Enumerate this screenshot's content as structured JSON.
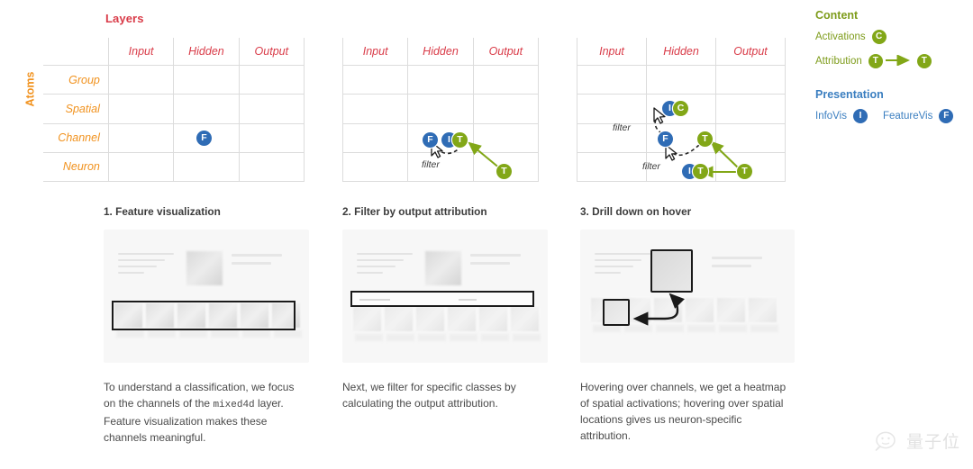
{
  "matrix": {
    "title": "Layers",
    "axis_label_y": "Atoms",
    "columns": [
      "Input",
      "Hidden",
      "Output"
    ],
    "rows": [
      "Group",
      "Spatial",
      "Channel",
      "Neuron"
    ],
    "filter_label": "filter",
    "colors": {
      "title": "#d93b48",
      "column_header": "#d93b48",
      "row_label": "#f1921e",
      "axis_label": "#f1921e",
      "grid": "#dcdcdc",
      "badge_blue": "#2f6cb5",
      "badge_green": "#82a717"
    },
    "instances": [
      {
        "id": "matrix-1",
        "badges": [
          {
            "letter": "F",
            "color": "blue",
            "row": "Channel",
            "column": "Hidden"
          }
        ],
        "filters": []
      },
      {
        "id": "matrix-2",
        "badges": [
          {
            "letter": "F",
            "color": "blue",
            "row": "Channel",
            "column": "Hidden"
          },
          {
            "letter": "I",
            "color": "blue",
            "row": "Channel",
            "column": "Hidden"
          },
          {
            "letter": "T",
            "color": "green",
            "row": "Channel",
            "column": "Hidden"
          },
          {
            "letter": "T",
            "color": "green",
            "row": "Neuron",
            "column": "Output"
          }
        ],
        "filters": [
          "filter"
        ]
      },
      {
        "id": "matrix-3",
        "badges": [
          {
            "letter": "I",
            "color": "blue",
            "row": "Spatial",
            "column": "Hidden"
          },
          {
            "letter": "C",
            "color": "green",
            "row": "Spatial",
            "column": "Hidden"
          },
          {
            "letter": "F",
            "color": "blue",
            "row": "Channel",
            "column": "Hidden"
          },
          {
            "letter": "T",
            "color": "green",
            "row": "Channel",
            "column": "Hidden"
          },
          {
            "letter": "I",
            "color": "blue",
            "row": "Neuron",
            "column": "Hidden"
          },
          {
            "letter": "T",
            "color": "green",
            "row": "Neuron",
            "column": "Hidden"
          },
          {
            "letter": "T",
            "color": "green",
            "row": "Neuron",
            "column": "Output"
          }
        ],
        "filters": [
          "filter",
          "filter"
        ]
      }
    ]
  },
  "legend": {
    "content": {
      "heading": "Content",
      "items": [
        {
          "label": "Activations",
          "badge": "C",
          "color": "green"
        },
        {
          "label": "Attribution",
          "badge_from": "T",
          "badge_to": "T",
          "color": "green",
          "arrow": true
        }
      ]
    },
    "presentation": {
      "heading": "Presentation",
      "items": [
        {
          "label": "InfoVis",
          "badge": "I",
          "color": "blue"
        },
        {
          "label": "FeatureVis",
          "badge": "F",
          "color": "blue"
        }
      ]
    },
    "colors": {
      "content_heading": "#7e9c1b",
      "presentation_heading": "#3a7ec0"
    }
  },
  "panels": [
    {
      "title": "1. Feature visualization",
      "caption_part1": "To understand a classification, we focus on the channels of the ",
      "caption_code": "mixed4d",
      "caption_part2": " layer. Feature visualization makes these channels meaningful."
    },
    {
      "title": "2. Filter by output attribution",
      "caption_part1": "Next, we filter for specific classes by calculating the output attribution.",
      "caption_code": "",
      "caption_part2": ""
    },
    {
      "title": "3. Drill down on hover",
      "caption_part1": "Hovering over channels, we get a heatmap of spatial activations; hovering over spatial locations gives us neuron-specific attribution.",
      "caption_code": "",
      "caption_part2": ""
    }
  ],
  "watermark": {
    "text": "量子位",
    "icon": "wechat-face-icon"
  }
}
